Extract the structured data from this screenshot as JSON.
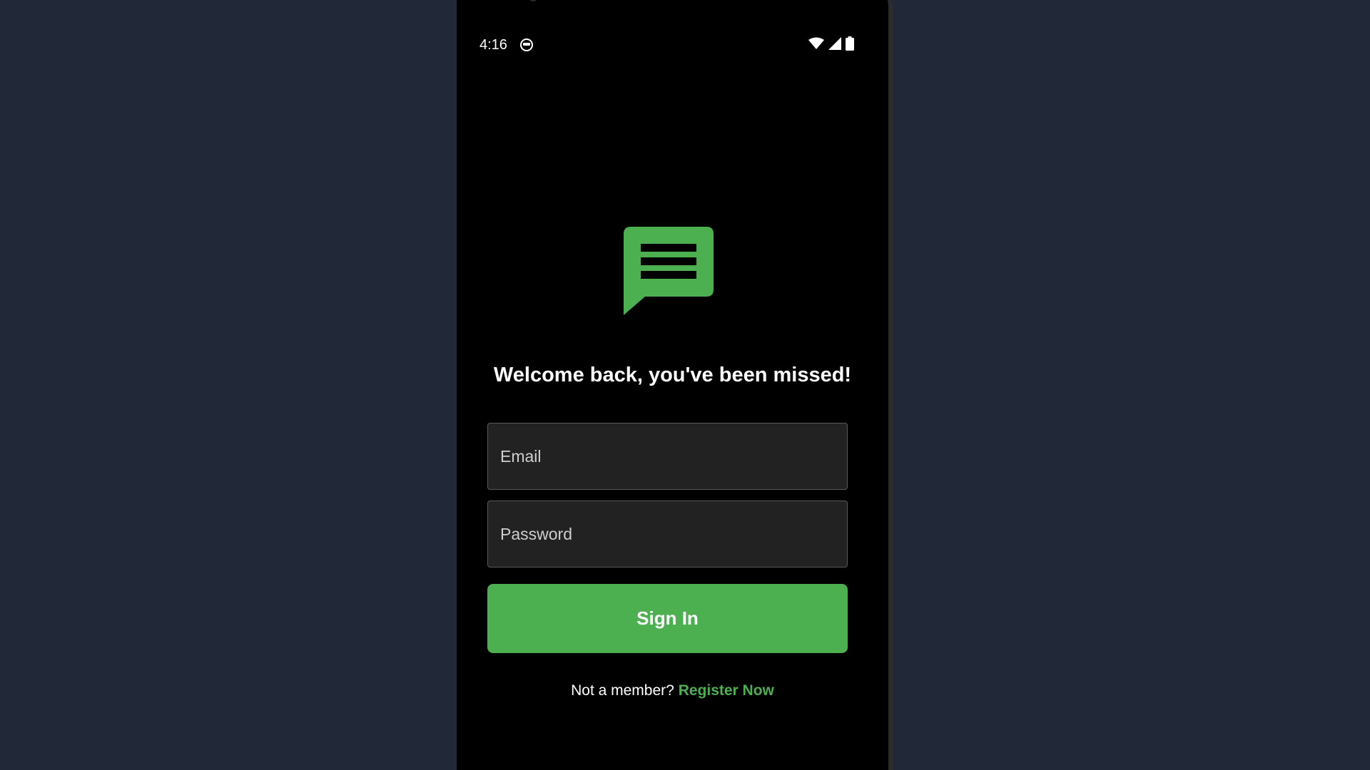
{
  "status_bar": {
    "time": "4:16",
    "icons": [
      "notification-icon",
      "wifi-icon",
      "signal-icon",
      "battery-icon"
    ]
  },
  "app": {
    "logo_icon": "chat-bubble-icon",
    "accent_color": "#4caf50",
    "welcome_text": "Welcome back, you've been missed!"
  },
  "form": {
    "email_placeholder": "Email",
    "password_placeholder": "Password",
    "signin_label": "Sign In"
  },
  "footer": {
    "prompt_text": "Not a member?",
    "register_label": "Register Now"
  }
}
